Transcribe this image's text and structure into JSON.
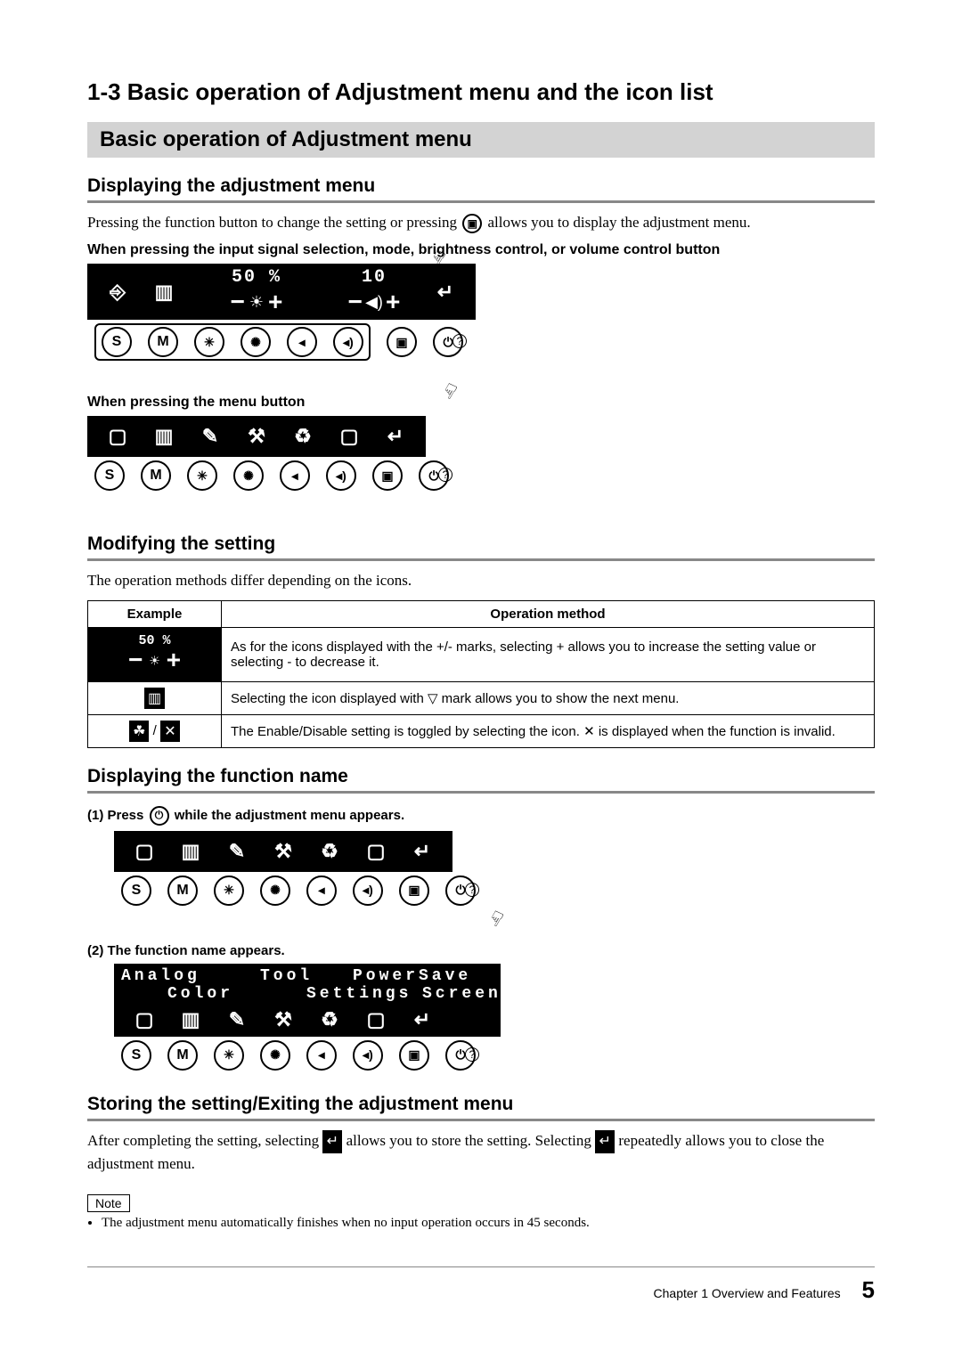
{
  "heading_main": "1-3  Basic operation of Adjustment menu and the icon list",
  "heading_bar": "Basic operation of Adjustment menu",
  "sec_display_menu": "Displaying the adjustment menu",
  "display_menu_text_a": "Pressing the function button to change the setting or pressing ",
  "display_menu_text_b": " allows you to display the adjustment menu.",
  "line_signal_press": "When pressing the input signal selection, mode, brightness control, or volume control button",
  "line_menu_press": "When pressing the menu button",
  "osd_brightness_pct": "50 %",
  "osd_volume_val": "10",
  "sec_modifying": "Modifying the setting",
  "modifying_text": "The operation methods differ depending on the icons.",
  "table": {
    "hdr_example": "Example",
    "hdr_method": "Operation method",
    "row1_ex": "50 %",
    "row1_txt": "As for the icons displayed with the +/- marks, selecting + allows you to increase the setting value or selecting - to decrease it.",
    "row2_txt": "Selecting the icon displayed with ▽ mark allows you to show the next menu.",
    "row3_txt_a": "The Enable/Disable setting is toggled by selecting the icon. ",
    "row3_txt_b": " is displayed when the function is invalid.",
    "row3_cross": "✕"
  },
  "sec_func_name": "Displaying the function name",
  "step1_a": "(1)   Press ",
  "step1_b": " while the adjustment menu appears.",
  "step2": "(2)   The function name appears.",
  "labels": {
    "analog": "Analog",
    "tool": "Tool",
    "power": "PowerSave",
    "color": "Color",
    "settings": "Settings",
    "screen": "Screen"
  },
  "sec_storing": "Storing the setting/Exiting the adjustment menu",
  "storing_text_a": "After completing the setting, selecting ",
  "storing_text_b": " allows you to store the setting. Selecting ",
  "storing_text_c": " repeatedly allows you to close the adjustment menu.",
  "note_label": "Note",
  "note_text": "The adjustment menu automatically finishes when no input operation occurs in 45 seconds.",
  "footer_chapter": "Chapter 1  Overview and Features",
  "footer_page": "5",
  "glyph": {
    "input": "⎆",
    "monitor": "▥",
    "brightness": "☀",
    "minus": "−",
    "plus": "+",
    "vol_low": "◀)",
    "vol_high": "◀))",
    "return": "↵",
    "screen": "▢",
    "tool": "✎",
    "settings": "⚒",
    "powersave": "♻",
    "eco": "☘",
    "btn_s": "S",
    "btn_m": "M",
    "bright_dim": "✳",
    "bright_up": "✺",
    "speak_low": "◂",
    "speak_high": "◂)",
    "menu": "▣",
    "power": "⏻",
    "help": "?",
    "cross": "✕",
    "hand": "☟",
    "nabla": "▽"
  }
}
